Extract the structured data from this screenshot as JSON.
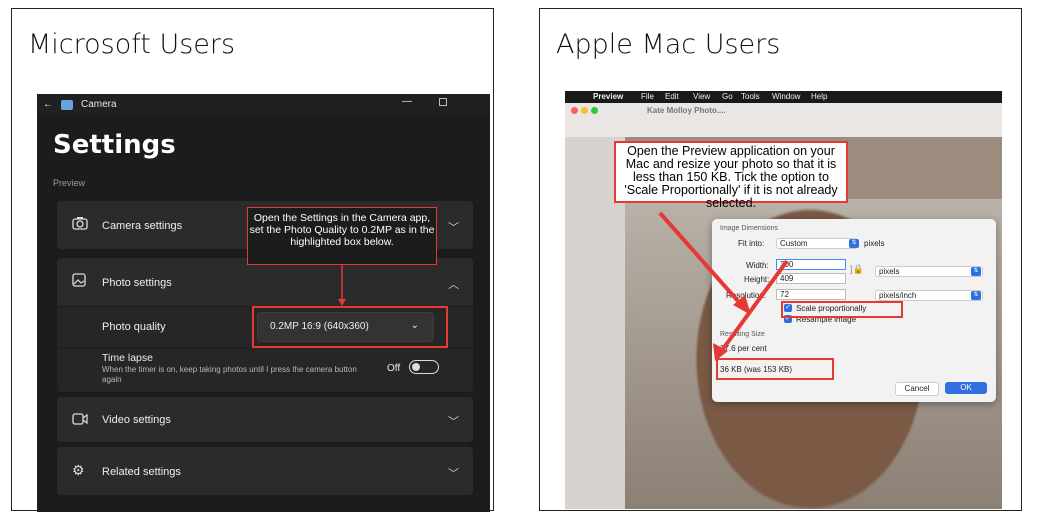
{
  "left_panel": {
    "title": "Microsoft Users",
    "app": {
      "back_glyph": "←",
      "app_name": "Camera",
      "heading": "Settings",
      "section": "Preview",
      "camera_settings": "Camera settings",
      "photo_settings": "Photo settings",
      "photo_quality_label": "Photo quality",
      "photo_quality_value": "0.2MP 16:9 (640x360)",
      "time_lapse_title": "Time lapse",
      "time_lapse_desc": "When the timer is on, keep taking photos until I press the camera button again",
      "time_lapse_state": "Off",
      "video_settings": "Video settings",
      "related_settings": "Related settings"
    },
    "callout": "Open the Settings in the Camera app, set the Photo Quality to 0.2MP as in the highlighted box below.",
    "colors": {
      "background": "#1c1c1c",
      "card": "#2b2b2b",
      "highlight": "#e53935"
    },
    "icons": [
      "back-icon",
      "camera-icon",
      "camera-outline-icon",
      "photo-icon",
      "video-icon",
      "gear-icon",
      "chevron-down-icon",
      "chevron-up-icon"
    ]
  },
  "right_panel": {
    "title": "Apple Mac Users",
    "menubar": {
      "apple": "",
      "items": [
        "Preview",
        "File",
        "Edit",
        "View",
        "Go",
        "Tools",
        "Window",
        "Help"
      ]
    },
    "window_title": "Kate Molloy Photo....",
    "callout": "Open the Preview application on your Mac and resize your photo so that it is less than 150 KB. Tick the option to 'Scale Proportionally' if it is not already selected.",
    "dialog": {
      "section_dimensions": "Image Dimensions",
      "fit_into_label": "Fit into:",
      "fit_into_value": "Custom",
      "fit_into_unit": "pixels",
      "width_label": "Width:",
      "width_value": "300",
      "height_label": "Height:",
      "height_value": "409",
      "size_unit": "pixels",
      "resolution_label": "Resolution:",
      "resolution_value": "72",
      "resolution_unit": "pixels/inch",
      "scale_proportionally": "Scale proportionally",
      "resample_image": "Resample image",
      "section_result": "Resulting Size",
      "percent": "37.6 per cent",
      "result_size": "36 KB (was 153 KB)",
      "cancel": "Cancel",
      "ok": "OK"
    },
    "colors": {
      "accent": "#2f6fe0",
      "highlight": "#e53935"
    }
  }
}
